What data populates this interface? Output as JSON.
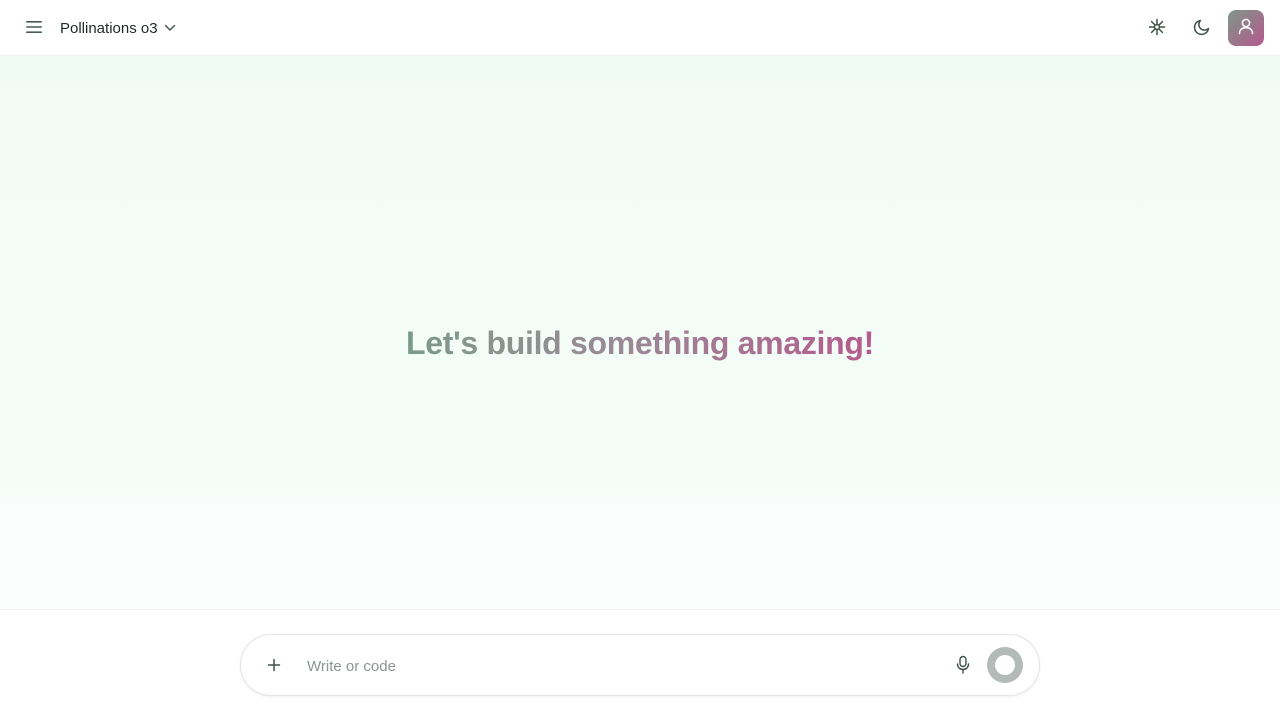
{
  "header": {
    "model_name": "Pollinations o3",
    "icons": {
      "menu": "hamburger-menu-icon",
      "model_dropdown": "chevron-down-icon",
      "spark": "spark-icon",
      "theme": "moon-icon",
      "user": "user-icon"
    }
  },
  "main": {
    "headline": "Let's build something amazing!"
  },
  "composer": {
    "placeholder": "Write or code",
    "value": "",
    "icons": {
      "attach": "plus-icon",
      "voice": "microphone-icon",
      "send": "stop-circle-icon"
    }
  },
  "colors": {
    "accent_green": "#7b9a89",
    "accent_pink": "#b55b8d",
    "background_mint": "#f1fbf5"
  }
}
